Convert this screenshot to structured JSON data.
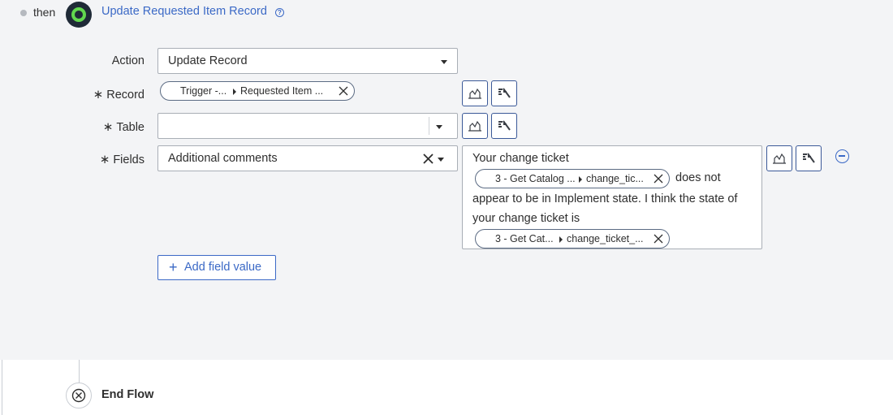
{
  "step": {
    "connector_word": "then",
    "title": "Update Requested Item Record",
    "help_icon": "question-circle-icon"
  },
  "form": {
    "action": {
      "label": "Action",
      "value": "Update Record"
    },
    "record": {
      "label": "Record",
      "required_marker": "∗",
      "pill": {
        "source": "Trigger -...",
        "field": "Requested Item ..."
      }
    },
    "table": {
      "label": "Table",
      "required_marker": "∗",
      "value": ""
    },
    "fields": {
      "label": "Fields",
      "required_marker": "∗",
      "field_name": "Additional comments",
      "value_text": {
        "line1": "Your change ticket",
        "pill1": {
          "source": "3 - Get Catalog ...",
          "field": "change_tic..."
        },
        "after_pill1": "does not",
        "line3": "appear to be in Implement state. I think the state of",
        "line4": "your change ticket is",
        "pill2": {
          "source": "3 - Get Cat...",
          "field": "change_ticket_..."
        }
      }
    },
    "add_field_label": "Add field value"
  },
  "end": {
    "title": "End Flow"
  },
  "colors": {
    "accent": "#3b69c6",
    "panel_bg": "#f3f4f6",
    "action_icon_bg": "#1f2a37",
    "action_icon_ring": "#62d84e"
  }
}
